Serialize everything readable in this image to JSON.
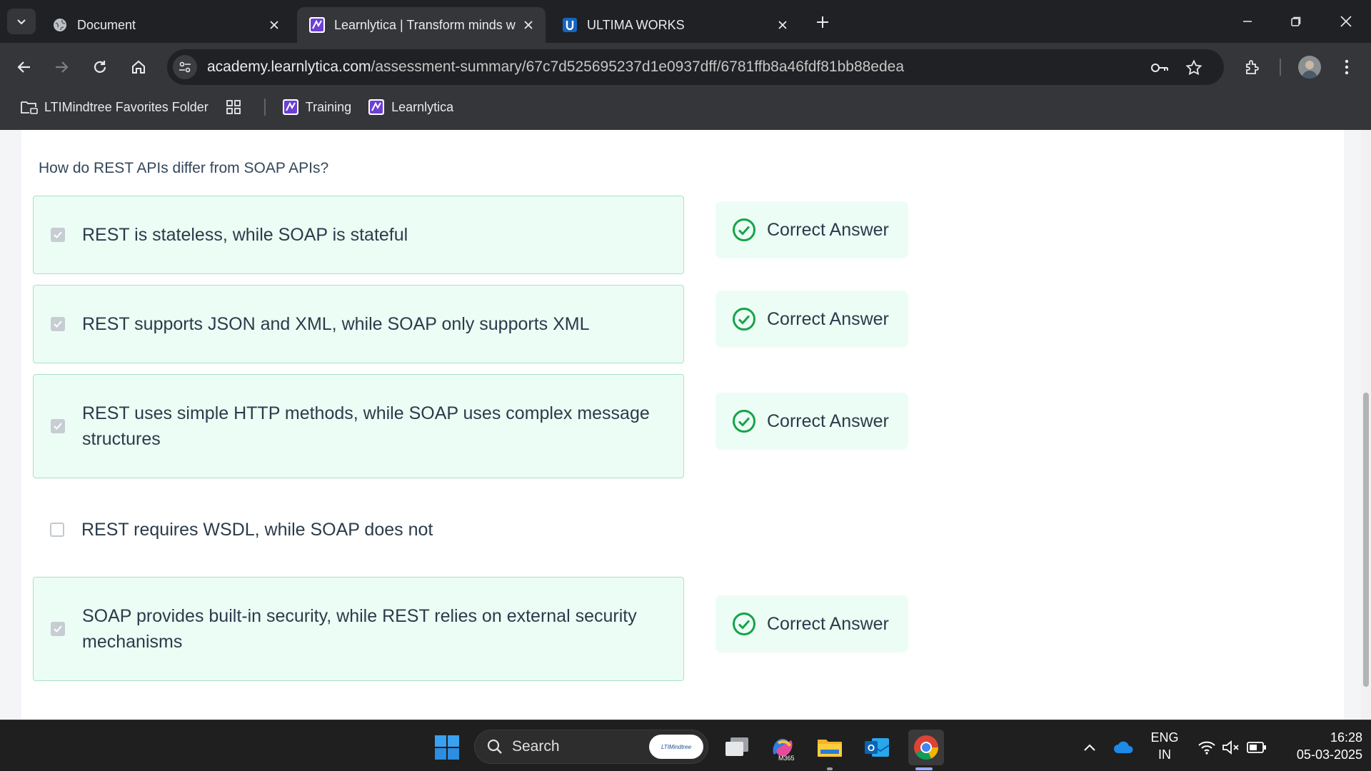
{
  "browser": {
    "tabs": [
      {
        "title": "Document",
        "active": false
      },
      {
        "title": "Learnlytica | Transform minds w",
        "active": true
      },
      {
        "title": "ULTIMA WORKS",
        "active": false
      }
    ],
    "url_host": "academy.learnlytica.com",
    "url_path": "/assessment-summary/67c7d525695237d1e0937dff/6781ffb8a46fdf81bb88edea",
    "bookmarks": [
      {
        "label": "LTIMindtree Favorites Folder"
      },
      {
        "label": "Training"
      },
      {
        "label": "Learnlytica"
      }
    ]
  },
  "question": {
    "text": "How do REST APIs differ from SOAP APIs?",
    "options": [
      {
        "text": "REST is stateless, while SOAP is stateful",
        "checked": true,
        "correct": true
      },
      {
        "text": "REST supports JSON and XML, while SOAP only supports XML",
        "checked": true,
        "correct": true
      },
      {
        "text": "REST uses simple HTTP methods, while SOAP uses complex message structures",
        "checked": true,
        "correct": true
      },
      {
        "text": "REST requires WSDL, while SOAP does not",
        "checked": false,
        "correct": false
      },
      {
        "text": "SOAP provides built-in security, while REST relies on external security mechanisms",
        "checked": true,
        "correct": true
      }
    ],
    "correct_label": "Correct Answer"
  },
  "taskbar": {
    "search_placeholder": "Search",
    "search_pill": "LTIMindtree",
    "m365_label": "M365",
    "language": "ENG",
    "region": "IN",
    "time": "16:28",
    "date": "05-03-2025"
  },
  "colors": {
    "correct_green": "#16a34a",
    "correct_bg": "#ecfdf5",
    "browser_dark": "#202124",
    "toolbar": "#35363a"
  }
}
